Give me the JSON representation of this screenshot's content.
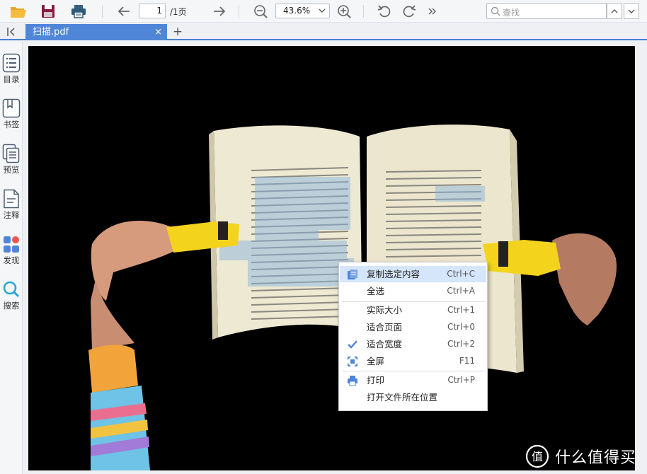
{
  "toolbar": {
    "page_current": "1",
    "page_total": "/1页",
    "zoom": "43.6%",
    "search_placeholder": "查找",
    "icons": [
      "open-folder-icon",
      "save-icon",
      "print-icon",
      "prev-page-icon",
      "next-page-icon",
      "zoom-out-icon",
      "zoom-in-icon",
      "rotate-left-icon",
      "rotate-right-icon",
      "more-icon",
      "search-icon",
      "search-prev-icon",
      "search-next-icon"
    ]
  },
  "tabbar": {
    "tab_label": "扫描.pdf",
    "close_symbol": "×",
    "new_tab_symbol": "+"
  },
  "sidebar": {
    "items": [
      {
        "label": "目录",
        "icon": "list-icon"
      },
      {
        "label": "书签",
        "icon": "bookmark-icon"
      },
      {
        "label": "预览",
        "icon": "pages-icon"
      },
      {
        "label": "注释",
        "icon": "annotation-icon"
      },
      {
        "label": "发现",
        "icon": "discover-icon"
      },
      {
        "label": "搜索",
        "icon": "search-icon"
      }
    ]
  },
  "context_menu": {
    "items": [
      {
        "label": "复制选定内容",
        "shortcut": "Ctrl+C",
        "icon": "copy-icon",
        "highlighted": true
      },
      {
        "label": "全选",
        "shortcut": "Ctrl+A"
      },
      {
        "label": "实际大小",
        "shortcut": "Ctrl+1"
      },
      {
        "label": "适合页面",
        "shortcut": "Ctrl+0"
      },
      {
        "label": "适合宽度",
        "shortcut": "Ctrl+2",
        "icon": "check-icon"
      },
      {
        "label": "全屏",
        "shortcut": "F11",
        "icon": "fullscreen-icon"
      },
      {
        "label": "打印",
        "shortcut": "Ctrl+P",
        "icon": "print-icon"
      },
      {
        "label": "打开文件所在位置",
        "shortcut": ""
      }
    ]
  },
  "watermark": {
    "logo_glyph": "值",
    "text": "什么值得买"
  },
  "colors": {
    "accent": "#4f86d8",
    "menu_highlight": "#d5e6fb",
    "toolbar_bg": "#f5f6f8"
  }
}
